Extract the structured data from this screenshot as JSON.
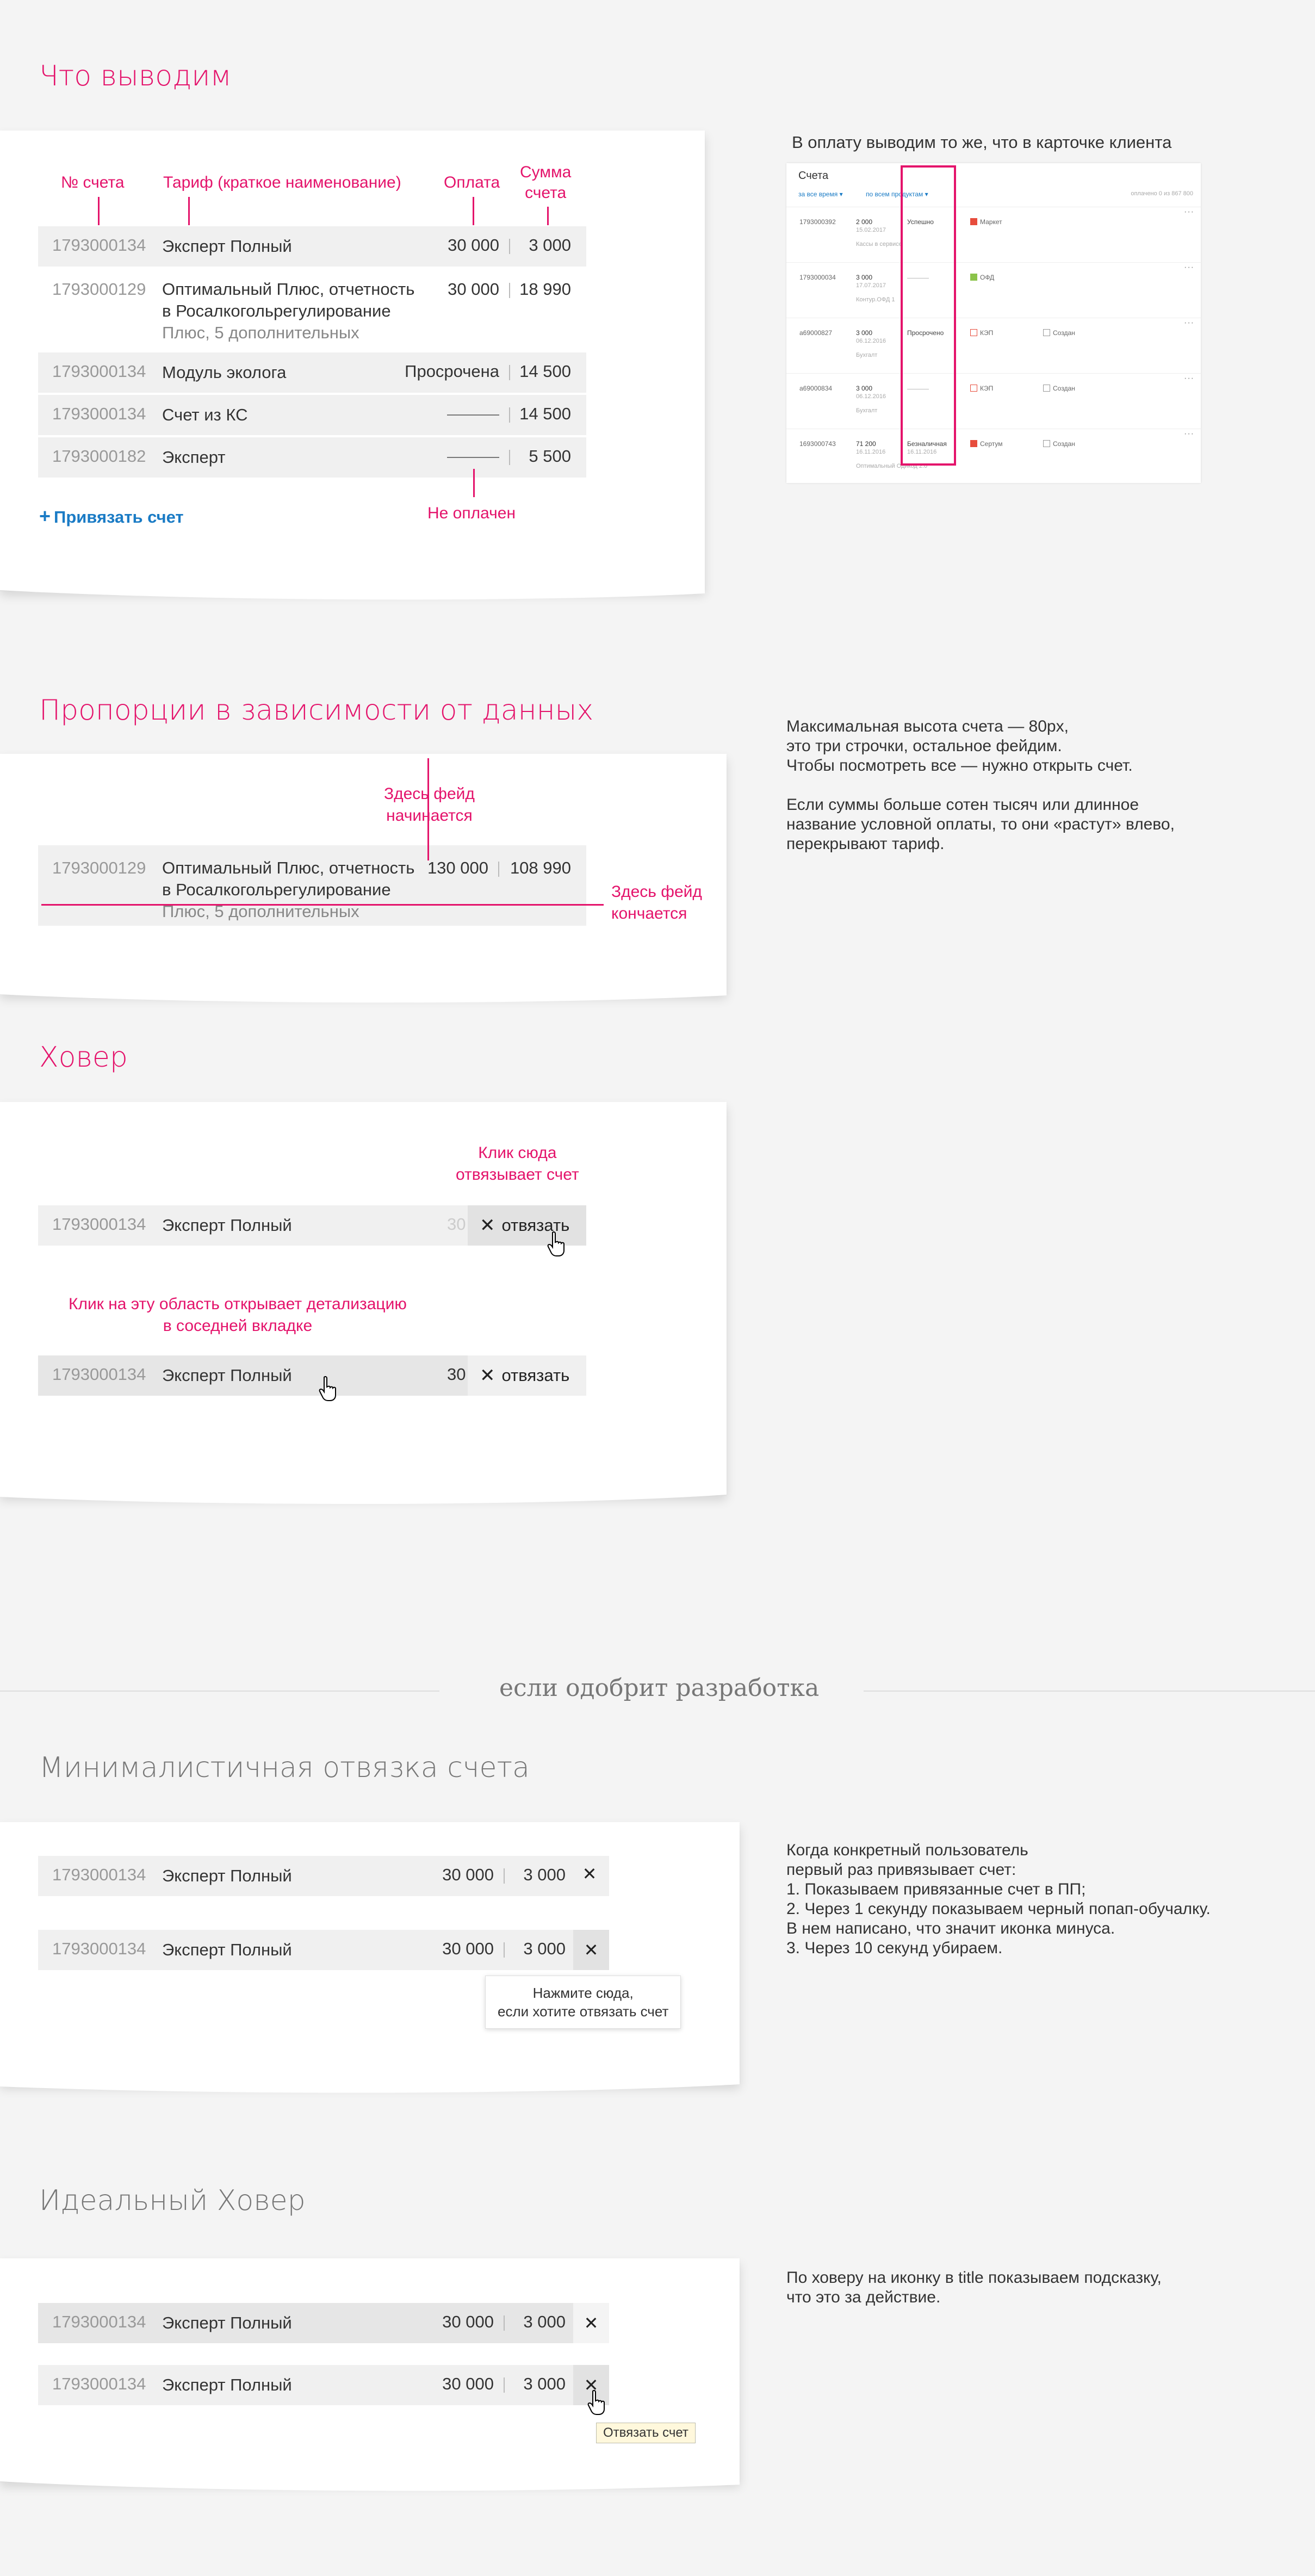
{
  "colors": {
    "accent": "#e4136b",
    "link": "#1a7bc5",
    "row_bg": "#f0f0f0"
  },
  "section1": {
    "title": "Что выводим",
    "annotations": {
      "num": "№ счета",
      "tariff": "Тариф (краткое наименование)",
      "payment": "Оплата",
      "sum_line1": "Сумма",
      "sum_line2": "счета",
      "unpaid": "Не оплачен"
    },
    "rows": [
      {
        "num": "1793000134",
        "tariff": "Эксперт Полный",
        "payment": "30 000",
        "sum": "3 000"
      },
      {
        "num": "1793000129",
        "tariff_line1": "Оптимальный Плюс, отчетность",
        "tariff_line2": "в Росалкогольрегулирование",
        "tariff_line3": "Плюс, 5 дополнительных",
        "payment": "30 000",
        "sum": "18 990"
      },
      {
        "num": "1793000134",
        "tariff": "Модуль эколога",
        "payment": "Просрочена",
        "sum": "14 500"
      },
      {
        "num": "1793000134",
        "tariff": "Счет из КС",
        "payment": "",
        "sum": "14 500"
      },
      {
        "num": "1793000182",
        "tariff": "Эксперт",
        "payment": "",
        "sum": "5 500"
      }
    ],
    "bind_link": "Привязать счет",
    "right_note": "В оплату выводим то же, что в карточке клиента",
    "mini": {
      "title": "Счета",
      "filter1": "за все время ▾",
      "filter2": "по всем продуктам ▾",
      "paid_text": "оплачено 0 из 867 800",
      "rows": [
        {
          "num": "1793000392",
          "amount": "2 000",
          "date": "15.02.2017",
          "note": "Кассы в сервисе",
          "status": "Успешно",
          "prod": "Маркет",
          "prod2": ""
        },
        {
          "num": "1793000034",
          "amount": "3 000",
          "date": "17.07.2017",
          "note": "Контур.ОФД 1",
          "status": "",
          "prod": "ОФД",
          "prod2": ""
        },
        {
          "num": "a69000827",
          "amount": "3 000",
          "date": "06.12.2016",
          "note": "Бухгалт",
          "status": "Просрочено",
          "prod": "КЭП",
          "prod2": "Создан"
        },
        {
          "num": "a69000834",
          "amount": "3 000",
          "date": "06.12.2016",
          "note": "Бухгалт",
          "status": "",
          "prod": "КЭП",
          "prod2": "Создан"
        },
        {
          "num": "1693000743",
          "amount": "71 200",
          "date": "16.11.2016",
          "note": "Оптимальный Одикод 2.0",
          "status": "Безналичная",
          "status_sub": "16.11.2016",
          "prod": "Сертум",
          "prod2": "Создан"
        }
      ]
    }
  },
  "section2": {
    "title": "Пропорции в зависимости от данных",
    "row": {
      "num": "1793000129",
      "tariff_line1": "Оптимальный Плюс, отчетность",
      "tariff_line2": "в Росалкогольрегулирование",
      "tariff_line3": "Плюс, 5 дополнительных",
      "payment": "130 000",
      "sum": "108 990"
    },
    "fade_start_line1": "Здесь фейд",
    "fade_start_line2": "начинается",
    "fade_end_line1": "Здесь фейд",
    "fade_end_line2": "кончается",
    "note_lines": [
      "Максимальная высота счета — 80px,",
      "это три строчки, остальное фейдим.",
      "Чтобы посмотреть все — нужно открыть счет.",
      "",
      "Если суммы больше сотен тысяч или длинное",
      "название условной оплаты, то они «растут» влево,",
      "перекрывают тариф."
    ]
  },
  "section3": {
    "title": "Ховер",
    "ann1_line1": "Клик сюда",
    "ann1_line2": "отвязывает счет",
    "ann2_line1": "Клик на эту область открывает детализацию",
    "ann2_line2": "в соседней вкладке",
    "row": {
      "num": "1793000134",
      "tariff": "Эксперт Полный",
      "payment_partial": "30"
    },
    "unbind_label": "отвязать"
  },
  "divider": {
    "text": "если одобрит разработка"
  },
  "section4": {
    "title": "Минималистичная отвязка счета",
    "row": {
      "num": "1793000134",
      "tariff": "Эксперт Полный",
      "payment": "30 000",
      "sum": "3 000"
    },
    "tooltip_line1": "Нажмите сюда,",
    "tooltip_line2": "если хотите отвязать счет",
    "note_lines": [
      "Когда конкретный пользователь",
      "первый раз привязывает счет:",
      "1. Показываем привязанные счет в ПП;",
      "2. Через 1 секунду показываем черный попап-обучалку.",
      "В нем написано, что значит иконка минуса.",
      "3. Через 10 секунд убираем."
    ]
  },
  "section5": {
    "title": "Идеальный Ховер",
    "row": {
      "num": "1793000134",
      "tariff": "Эксперт Полный",
      "payment": "30 000",
      "sum": "3 000"
    },
    "title_tooltip": "Отвязать счет",
    "note_lines": [
      "По ховеру на иконку в title показываем подсказку,",
      "что это за действие."
    ]
  },
  "icons": {
    "close": "close-icon",
    "plus": "plus-icon",
    "cursor": "hand-cursor-icon"
  }
}
